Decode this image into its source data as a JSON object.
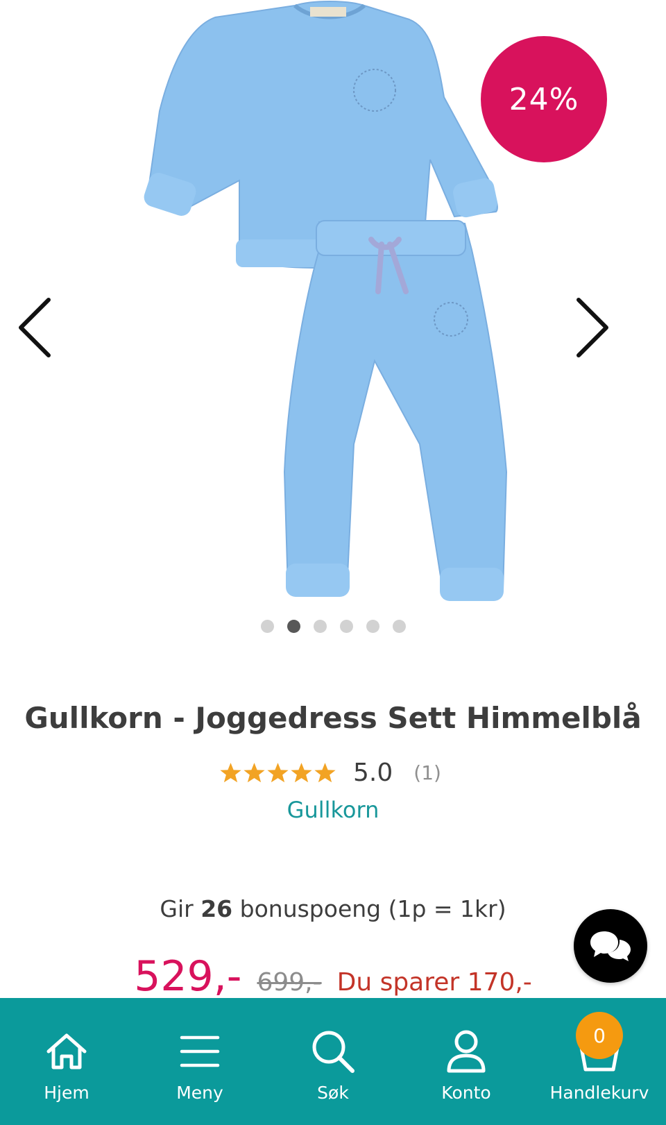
{
  "product": {
    "discount_badge": "24%",
    "title": "Gullkorn - Joggedress Sett Himmelblå",
    "rating": {
      "stars": 5,
      "score": "5.0",
      "count": "(1)"
    },
    "brand": "Gullkorn",
    "bonus": {
      "prefix": "Gir",
      "points": "26",
      "suffix": "bonuspoeng (1p = 1kr)"
    },
    "price": {
      "current": "529,-",
      "old": "699,-",
      "savings": "Du sparer 170,-"
    },
    "image": {
      "color": "#8cc1ee",
      "label": "blue-sweatsuit-set"
    }
  },
  "gallery": {
    "total": 6,
    "active_index": 1
  },
  "colors": {
    "accent_pink": "#d8125c",
    "teal": "#0b9a9b",
    "star": "#f2a324",
    "badge_orange": "#f59a10",
    "save_red": "#c33428",
    "brand_link": "#18979a"
  },
  "bottom_nav": [
    {
      "label": "Hjem",
      "icon": "home-icon"
    },
    {
      "label": "Meny",
      "icon": "menu-icon"
    },
    {
      "label": "Søk",
      "icon": "search-icon"
    },
    {
      "label": "Konto",
      "icon": "user-icon"
    },
    {
      "label": "Handlekurv",
      "icon": "cart-icon",
      "badge": "0"
    }
  ]
}
